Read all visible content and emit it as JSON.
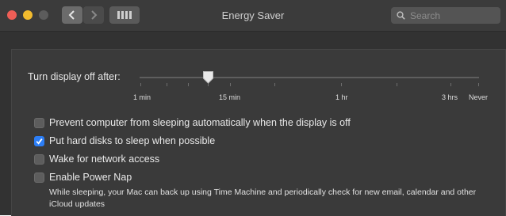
{
  "window": {
    "title": "Energy Saver"
  },
  "toolbar": {
    "search_placeholder": "Search"
  },
  "slider": {
    "label": "Turn display off after:",
    "ticks": [
      "1 min",
      "15 min",
      "1 hr",
      "3 hrs",
      "Never"
    ],
    "selected": "15 min"
  },
  "options": [
    {
      "label": "Prevent computer from sleeping automatically when the display is off",
      "checked": false
    },
    {
      "label": "Put hard disks to sleep when possible",
      "checked": true
    },
    {
      "label": "Wake for network access",
      "checked": false
    },
    {
      "label": "Enable Power Nap",
      "checked": false
    }
  ],
  "power_nap_description": "While sleeping, your Mac can back up using Time Machine and periodically check for new email, calendar and other iCloud updates",
  "colors": {
    "accent": "#2c7ef6",
    "background": "#323232",
    "panel": "#3a3a3a"
  }
}
